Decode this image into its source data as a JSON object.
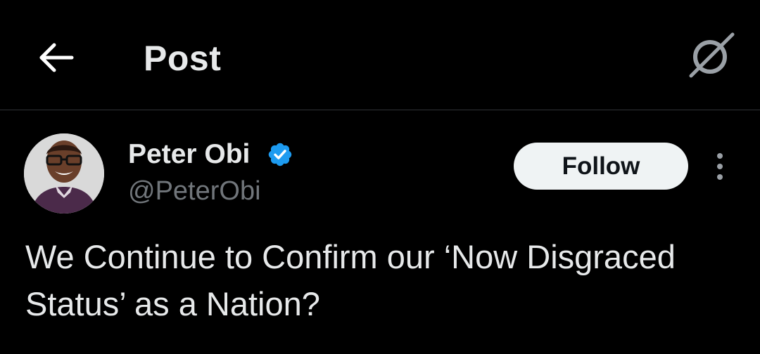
{
  "header": {
    "back_icon": "arrow-left-icon",
    "title": "Post",
    "grok_icon": "grok-icon"
  },
  "post": {
    "author": {
      "name": "Peter Obi",
      "handle": "@PeterObi",
      "verified": true,
      "verified_icon": "verified-badge-icon",
      "verified_color": "#1d9bf0"
    },
    "follow_label": "Follow",
    "more_icon": "more-vertical-icon",
    "text": "We Continue to Confirm our ‘Now Disgraced Status’ as a Nation?"
  },
  "colors": {
    "background": "#000000",
    "text_primary": "#e7e9ea",
    "text_secondary": "#71767b",
    "divider": "#2f3336",
    "follow_bg": "#eff3f4",
    "follow_text": "#0f1419"
  }
}
